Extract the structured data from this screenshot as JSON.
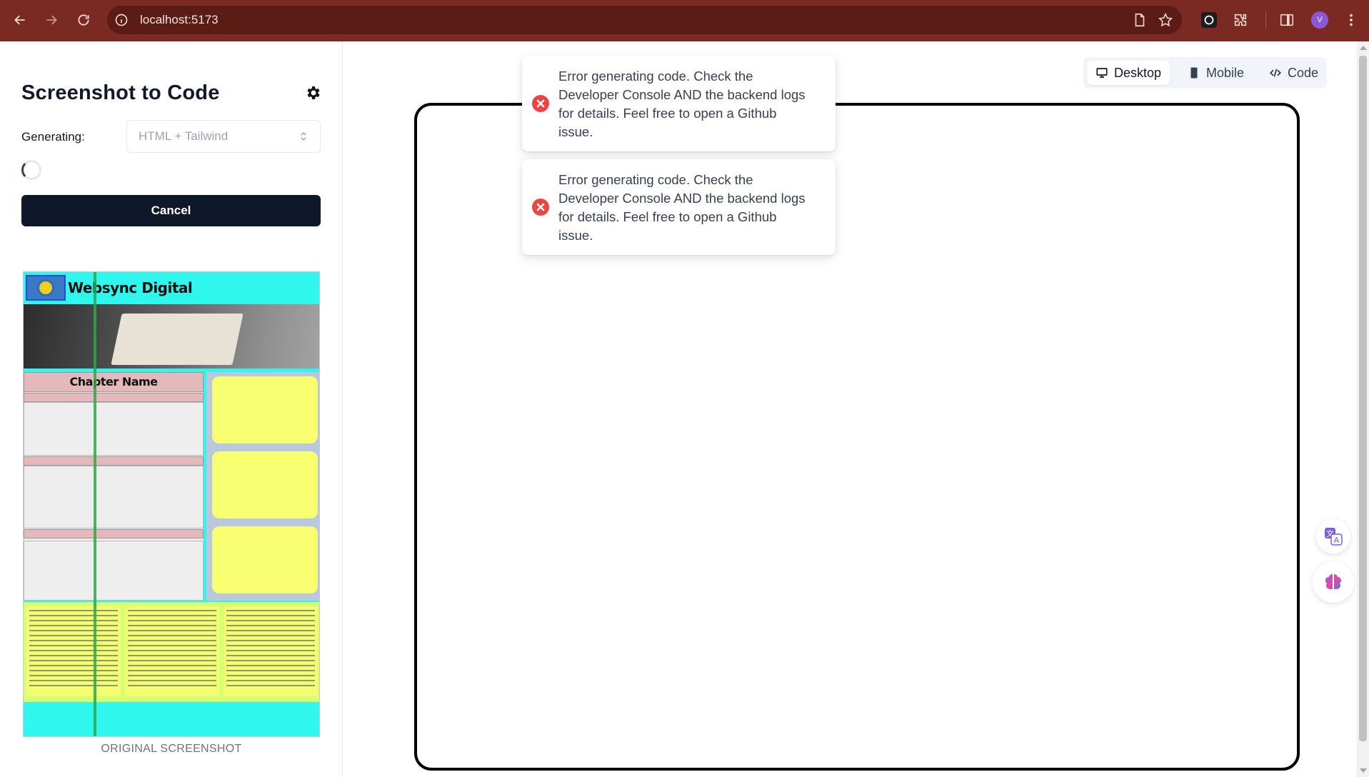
{
  "browser": {
    "url": "localhost:5173",
    "avatar_initial": "V"
  },
  "sidebar": {
    "app_title": "Screenshot to Code",
    "generating_label": "Generating:",
    "stack_select_value": "HTML + Tailwind",
    "cancel_label": "Cancel",
    "thumbnail_caption": "ORIGINAL SCREENSHOT"
  },
  "thumbnail": {
    "site_title": "Websync Digital",
    "chapter_header": "Chapter Name"
  },
  "view_tabs": [
    {
      "label": "Desktop",
      "active": true,
      "icon": "monitor-icon"
    },
    {
      "label": "Mobile",
      "active": false,
      "icon": "smartphone-icon"
    },
    {
      "label": "Code",
      "active": false,
      "icon": "code-icon"
    }
  ],
  "toasts": [
    {
      "message": "Error generating code. Check the Developer Console AND the backend logs for details. Feel free to open a Github issue.",
      "type": "error"
    },
    {
      "message": "Error generating code. Check the Developer Console AND the backend logs for details. Feel free to open a Github issue.",
      "type": "error"
    }
  ],
  "colors": {
    "chrome_bg": "#7a2a22",
    "cancel_bg": "#0f172a",
    "error_red": "#ef4444",
    "thumb_cyan": "#2ff7ee",
    "thumb_yellow": "#f8ff70"
  }
}
